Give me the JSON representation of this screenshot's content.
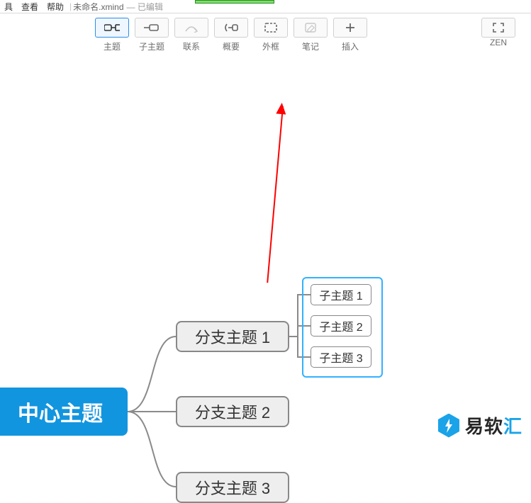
{
  "menubar": {
    "items": [
      "具",
      "查看",
      "帮助"
    ],
    "filename": "未命名.xmind",
    "status": "— 已编辑"
  },
  "toolbar": {
    "items": [
      {
        "label": "主题",
        "icon": "topic-icon",
        "state": "active"
      },
      {
        "label": "子主题",
        "icon": "subtopic-icon",
        "state": "normal"
      },
      {
        "label": "联系",
        "icon": "relation-icon",
        "state": "disabled"
      },
      {
        "label": "概要",
        "icon": "summary-icon",
        "state": "normal"
      },
      {
        "label": "外框",
        "icon": "boundary-icon",
        "state": "normal"
      },
      {
        "label": "笔记",
        "icon": "note-icon",
        "state": "disabled"
      },
      {
        "label": "插入",
        "icon": "insert-icon",
        "state": "normal"
      }
    ],
    "zen_label": "ZEN"
  },
  "mindmap": {
    "central": "中心主题",
    "branches": [
      "分支主题 1",
      "分支主题 2",
      "分支主题 3"
    ],
    "subtopics": [
      "子主题 1",
      "子主题 2",
      "子主题 3"
    ]
  },
  "watermark": {
    "text_a": "易软",
    "text_b": "汇"
  }
}
